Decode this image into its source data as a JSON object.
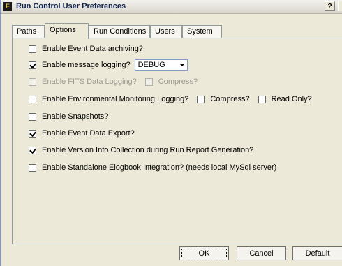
{
  "window": {
    "title": "Run Control User Preferences",
    "help_label": "?"
  },
  "tabs": [
    {
      "label": "Paths"
    },
    {
      "label": "Options"
    },
    {
      "label": "Run Conditions"
    },
    {
      "label": "Users"
    },
    {
      "label": "System"
    }
  ],
  "options": {
    "event_archiving": {
      "label": "Enable Event Data archiving?",
      "checked": false
    },
    "message_logging": {
      "label": "Enable message logging?",
      "checked": true,
      "level": "DEBUG"
    },
    "fits_logging": {
      "label": "Enable FITS Data Logging?",
      "checked": false,
      "enabled": false,
      "compress_label": "Compress?"
    },
    "env_logging": {
      "label": "Enable Environmental Monitoring Logging?",
      "checked": false,
      "compress_label": "Compress?",
      "readonly_label": "Read Only?"
    },
    "snapshots": {
      "label": "Enable Snapshots?",
      "checked": false
    },
    "event_export": {
      "label": "Enable Event Data Export?",
      "checked": true
    },
    "version_info": {
      "label": "Enable Version Info Collection during Run Report Generation?",
      "checked": true
    },
    "elogbook": {
      "label": "Enable Standalone Elogbook Integration? (needs local MySql server)",
      "checked": false
    }
  },
  "buttons": {
    "ok": "OK",
    "cancel": "Cancel",
    "default": "Default"
  }
}
